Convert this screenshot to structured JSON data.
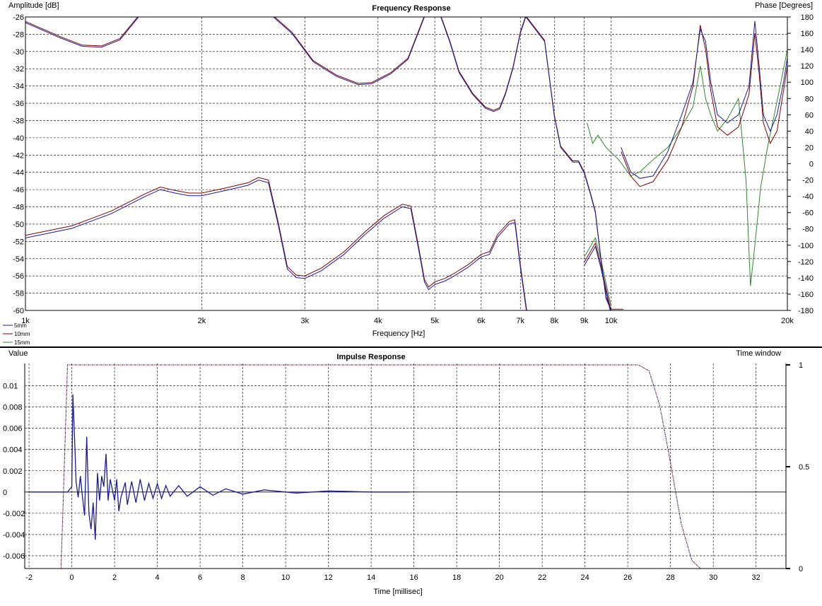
{
  "chart_data": [
    {
      "type": "line",
      "title": "Frequency Response",
      "xlabel": "Frequency [Hz]",
      "ylabel": "Amplitude [dB]",
      "y2label": "Phase [Degrees]",
      "xscale": "log",
      "xlim": [
        1000,
        20000
      ],
      "ylim": [
        -60,
        -26
      ],
      "y2lim": [
        -180,
        180
      ],
      "x_ticks": [
        1000,
        2000,
        3000,
        4000,
        5000,
        6000,
        7000,
        8000,
        9000,
        10000,
        20000
      ],
      "x_tick_labels": [
        "1k",
        "2k",
        "3k",
        "4k",
        "5k",
        "6k",
        "7k",
        "8k",
        "9k",
        "10k",
        "20k"
      ],
      "y_ticks": [
        -26,
        -28,
        -30,
        -32,
        -34,
        -36,
        -38,
        -40,
        -42,
        -44,
        -46,
        -48,
        -50,
        -52,
        -54,
        -56,
        -58,
        -60
      ],
      "y2_ticks": [
        180,
        160,
        140,
        120,
        100,
        80,
        60,
        40,
        20,
        0,
        -20,
        -40,
        -60,
        -80,
        -100,
        -120,
        -140,
        -160,
        -180
      ],
      "grid": true,
      "legend_position": "bottom-left",
      "series": [
        {
          "name": "5mm",
          "color": "#1a1aa0",
          "amplitude": [
            [
              1000,
              -51.6
            ],
            [
              1200,
              -50.5
            ],
            [
              1400,
              -48.8
            ],
            [
              1600,
              -46.8
            ],
            [
              1700,
              -46.0
            ],
            [
              1800,
              -46.4
            ],
            [
              1900,
              -46.7
            ],
            [
              2000,
              -46.7
            ],
            [
              2200,
              -46.1
            ],
            [
              2400,
              -45.5
            ],
            [
              2500,
              -44.9
            ],
            [
              2600,
              -45.2
            ],
            [
              2700,
              -50
            ],
            [
              2800,
              -55.2
            ],
            [
              2900,
              -56.2
            ],
            [
              3000,
              -56.3
            ],
            [
              3200,
              -55.4
            ],
            [
              3500,
              -53.5
            ],
            [
              3800,
              -51.2
            ],
            [
              4100,
              -49.3
            ],
            [
              4400,
              -48
            ],
            [
              4550,
              -48.2
            ],
            [
              4700,
              -53.2
            ],
            [
              4800,
              -56.7
            ],
            [
              4880,
              -57.6
            ],
            [
              5000,
              -57
            ],
            [
              5200,
              -56.6
            ],
            [
              5400,
              -56
            ],
            [
              5700,
              -55
            ],
            [
              6000,
              -53.8
            ],
            [
              6200,
              -53.5
            ],
            [
              6400,
              -51.5
            ],
            [
              6700,
              -50
            ],
            [
              6850,
              -49.8
            ],
            [
              7000,
              -55
            ],
            [
              7200,
              -61
            ]
          ],
          "amplitude_tail": [
            [
              9000,
              -54.8
            ],
            [
              9400,
              -52.6
            ],
            [
              9600,
              -55
            ],
            [
              10000,
              -60.5
            ]
          ],
          "phase": [
            [
              1000,
              173
            ],
            [
              1150,
              154
            ],
            [
              1250,
              144
            ],
            [
              1350,
              143
            ],
            [
              1450,
              152
            ],
            [
              1560,
              180
            ],
            [
              2650,
              180
            ],
            [
              2850,
              160
            ],
            [
              3100,
              125
            ],
            [
              3400,
              107
            ],
            [
              3700,
              97
            ],
            [
              3900,
              98
            ],
            [
              4200,
              110
            ],
            [
              4500,
              128
            ],
            [
              4800,
              180
            ],
            [
              5120,
              180
            ],
            [
              5300,
              150
            ],
            [
              5500,
              112
            ],
            [
              5800,
              85
            ],
            [
              6100,
              68
            ],
            [
              6300,
              64
            ],
            [
              6450,
              67
            ],
            [
              6600,
              85
            ],
            [
              6800,
              117
            ],
            [
              7000,
              160
            ],
            [
              7150,
              180
            ],
            [
              7700,
              150
            ],
            [
              8000,
              58
            ],
            [
              8200,
              20
            ],
            [
              8600,
              2
            ],
            [
              8800,
              2
            ],
            [
              9000,
              -12
            ],
            [
              9200,
              -35
            ],
            [
              9400,
              -60
            ],
            [
              9600,
              -115
            ],
            [
              9800,
              -165
            ],
            [
              10000,
              -180
            ],
            [
              10500,
              -180
            ]
          ],
          "phase_tail": [
            [
              10400,
              20
            ],
            [
              10800,
              -10
            ],
            [
              11200,
              -18
            ],
            [
              11800,
              -15
            ],
            [
              12500,
              15
            ],
            [
              13200,
              60
            ],
            [
              13800,
              100
            ],
            [
              14200,
              165
            ],
            [
              14500,
              150
            ],
            [
              14800,
              100
            ],
            [
              15200,
              60
            ],
            [
              15800,
              50
            ],
            [
              16500,
              60
            ],
            [
              17200,
              95
            ],
            [
              17600,
              175
            ],
            [
              17900,
              120
            ],
            [
              18200,
              60
            ],
            [
              18700,
              40
            ],
            [
              19200,
              60
            ],
            [
              19700,
              100
            ],
            [
              20000,
              130
            ]
          ]
        },
        {
          "name": "10mm",
          "color": "#800000",
          "phase_tail": [
            [
              10400,
              15
            ],
            [
              10800,
              -15
            ],
            [
              11200,
              -28
            ],
            [
              11800,
              -22
            ],
            [
              12500,
              5
            ],
            [
              13200,
              45
            ],
            [
              13800,
              95
            ],
            [
              14200,
              170
            ],
            [
              14500,
              140
            ],
            [
              14800,
              90
            ],
            [
              15200,
              45
            ],
            [
              15800,
              35
            ],
            [
              16500,
              45
            ],
            [
              17200,
              85
            ],
            [
              17600,
              160
            ],
            [
              17900,
              110
            ],
            [
              18200,
              50
            ],
            [
              18700,
              25
            ],
            [
              19200,
              40
            ],
            [
              19700,
              90
            ],
            [
              20000,
              120
            ]
          ]
        },
        {
          "name": "15mm",
          "color": "#2a8a2a",
          "phase_tail": [
            [
              9100,
              50
            ],
            [
              9300,
              25
            ],
            [
              9500,
              35
            ],
            [
              9800,
              20
            ],
            [
              10300,
              5
            ],
            [
              10800,
              -15
            ],
            [
              11200,
              -10
            ],
            [
              11800,
              5
            ],
            [
              12500,
              20
            ],
            [
              13200,
              45
            ],
            [
              13800,
              70
            ],
            [
              14200,
              120
            ],
            [
              14500,
              80
            ],
            [
              14800,
              60
            ],
            [
              15200,
              40
            ],
            [
              15800,
              55
            ],
            [
              16500,
              80
            ],
            [
              17000,
              -20
            ],
            [
              17300,
              -150
            ],
            [
              17600,
              -100
            ],
            [
              18000,
              -30
            ],
            [
              18500,
              20
            ],
            [
              19000,
              60
            ],
            [
              19500,
              100
            ],
            [
              20000,
              140
            ]
          ]
        }
      ]
    },
    {
      "type": "line",
      "title": "Impulse Response",
      "xlabel": "Time [millisec]",
      "ylabel": "Value",
      "y2label": "Time window",
      "xlim": [
        -2.2,
        33.4
      ],
      "ylim": [
        -0.0072,
        0.0121
      ],
      "y2lim": [
        0,
        1
      ],
      "x_ticks": [
        -2,
        0,
        2,
        4,
        6,
        8,
        10,
        12,
        14,
        16,
        18,
        20,
        22,
        24,
        26,
        28,
        30,
        32
      ],
      "y_ticks": [
        0.01,
        0.008,
        0.006,
        0.004,
        0.002,
        0,
        -0.002,
        -0.004,
        -0.006
      ],
      "y_tick_labels": [
        "0.01",
        "0.008",
        "0.006",
        "0.004",
        "0.002",
        "0",
        "-0.002",
        "-0.004",
        "-0.006"
      ],
      "y2_ticks": [
        1,
        0.5,
        0
      ],
      "y2_tick_labels": [
        "1",
        "0.5",
        "0"
      ],
      "grid": true,
      "series": [
        {
          "name": "",
          "color": "#1a1aa0",
          "impulse": [
            [
              -2,
              0
            ],
            [
              -0.2,
              0
            ],
            [
              0,
              0.0005
            ],
            [
              0.05,
              0.0092
            ],
            [
              0.15,
              0.004
            ],
            [
              0.2,
              0.001
            ],
            [
              0.3,
              -0.0005
            ],
            [
              0.4,
              0.0015
            ],
            [
              0.5,
              -0.0005
            ],
            [
              0.6,
              -0.0022
            ],
            [
              0.7,
              0.0052
            ],
            [
              0.8,
              -0.002
            ],
            [
              0.9,
              -0.0035
            ],
            [
              1.0,
              -0.001
            ],
            [
              1.1,
              -0.0045
            ],
            [
              1.2,
              0.0018
            ],
            [
              1.3,
              -0.0008
            ],
            [
              1.4,
              0.0015
            ],
            [
              1.5,
              0.0005
            ],
            [
              1.6,
              0.0036
            ],
            [
              1.7,
              -0.0008
            ],
            [
              1.8,
              0.0012
            ],
            [
              1.9,
              0.0002
            ],
            [
              2.0,
              -0.0008
            ],
            [
              2.1,
              0.0012
            ],
            [
              2.2,
              -0.0018
            ],
            [
              2.3,
              -0.0005
            ],
            [
              2.5,
              0.0009
            ],
            [
              2.6,
              -0.0012
            ],
            [
              2.8,
              0.001
            ],
            [
              3.0,
              -0.001
            ],
            [
              3.2,
              0.0012
            ],
            [
              3.4,
              -0.0008
            ],
            [
              3.6,
              0.0008
            ],
            [
              3.8,
              -0.0006
            ],
            [
              4.0,
              0.0008
            ],
            [
              4.2,
              -0.0006
            ],
            [
              4.4,
              0.0006
            ],
            [
              4.6,
              -0.0004
            ],
            [
              5.0,
              0.0006
            ],
            [
              5.4,
              -0.0004
            ],
            [
              6.0,
              0.0005
            ],
            [
              6.6,
              -0.0003
            ],
            [
              7.2,
              0.0003
            ],
            [
              8.0,
              -0.0002
            ],
            [
              9.0,
              0.0002
            ],
            [
              10.5,
              -0.0001
            ],
            [
              12.0,
              0.0001
            ],
            [
              14.0,
              0
            ],
            [
              15.8,
              0
            ]
          ],
          "time_window": [
            [
              -2.2,
              0
            ],
            [
              -0.5,
              0
            ],
            [
              -0.2,
              1
            ],
            [
              26.5,
              1
            ],
            [
              27.0,
              0.97
            ],
            [
              27.5,
              0.8
            ],
            [
              28.0,
              0.52
            ],
            [
              28.5,
              0.22
            ],
            [
              29.0,
              0.04
            ],
            [
              29.4,
              0
            ],
            [
              33.4,
              0
            ]
          ]
        }
      ]
    }
  ]
}
